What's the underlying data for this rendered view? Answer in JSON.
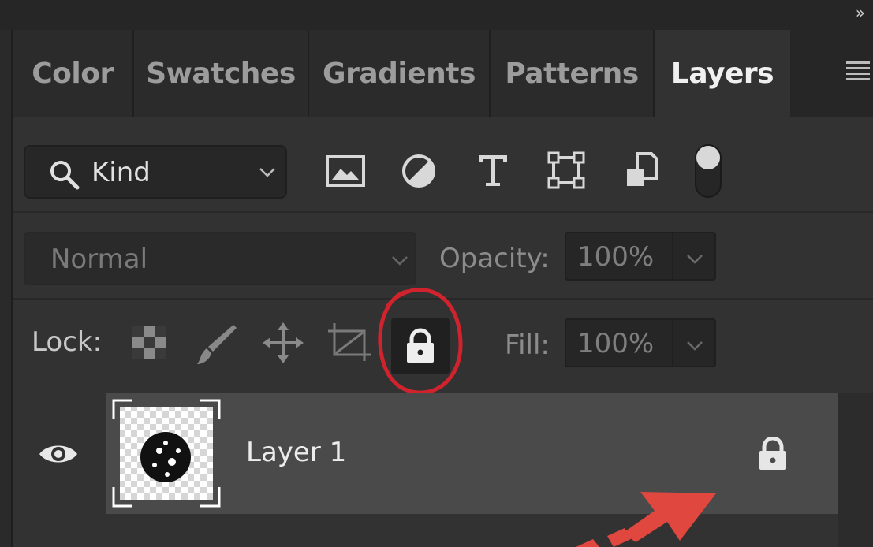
{
  "toolbar": {
    "collapse_glyph": "»"
  },
  "tabs": [
    {
      "label": "Color",
      "active": false
    },
    {
      "label": "Swatches",
      "active": false
    },
    {
      "label": "Gradients",
      "active": false
    },
    {
      "label": "Patterns",
      "active": false
    },
    {
      "label": "Layers",
      "active": true
    }
  ],
  "filter": {
    "kind_label": "Kind",
    "icons": [
      "pixel-layer-filter-icon",
      "adjustment-layer-filter-icon",
      "type-layer-filter-icon",
      "shape-layer-filter-icon",
      "smart-object-filter-icon",
      "filter-toggle-switch"
    ]
  },
  "blend": {
    "mode": "Normal",
    "opacity_label": "Opacity:",
    "opacity_value": "100%"
  },
  "lock": {
    "label": "Lock:",
    "icons": [
      "lock-transparent-pixels-icon",
      "lock-image-pixels-icon",
      "lock-position-icon",
      "lock-artboard-icon",
      "lock-all-icon"
    ],
    "fill_label": "Fill:",
    "fill_value": "100%"
  },
  "layers": [
    {
      "name": "Layer 1",
      "visible": true,
      "locked": true
    }
  ],
  "annotations": {
    "circle_color": "#d0232e",
    "arrow_color": "#e0473f"
  },
  "colors": {
    "panel_bg": "#323232",
    "tab_bar_bg": "#262626",
    "selected_layer_bg": "#4a4a4a"
  }
}
